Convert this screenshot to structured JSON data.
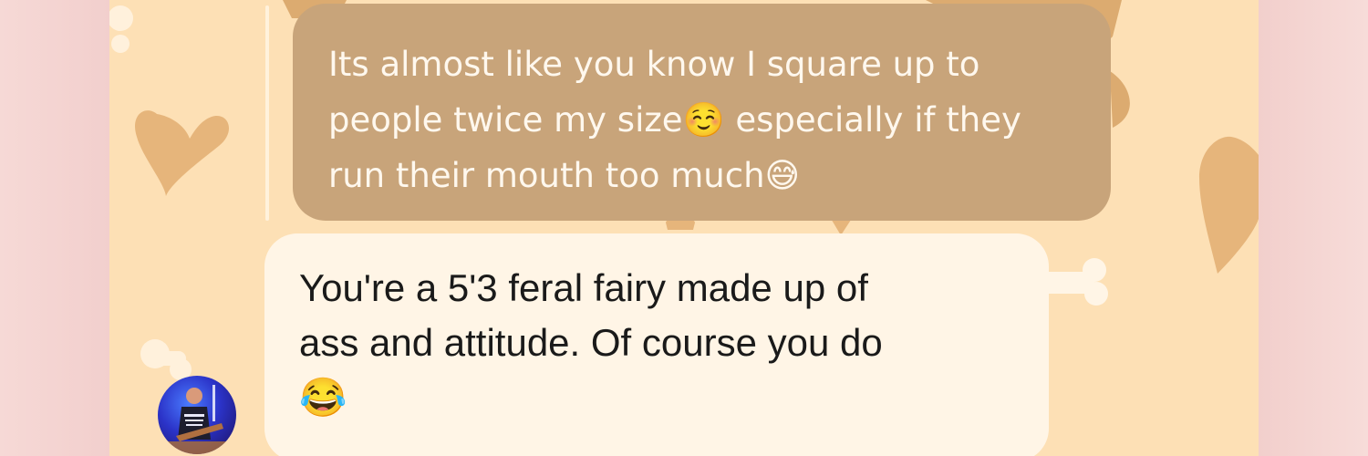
{
  "messages": {
    "quoted": {
      "text_1": "Its almost like you know I square up to",
      "text_2": "people twice my size",
      "text_3": " especially if they",
      "text_4": "run their mouth too much"
    },
    "reply": {
      "text_1": "You're a 5'3 feral fairy made up of",
      "text_2": "ass and attitude. Of course you do"
    }
  },
  "emojis": {
    "smiling_blush": "☺️",
    "sweat_smile": "😅",
    "tears_of_joy": "😂"
  },
  "theme": {
    "panel_background": "#fde0b5",
    "quoted_bubble": "#c8a47a",
    "reply_bubble": "#fff5e6",
    "side_background": "#f3cfd0"
  }
}
